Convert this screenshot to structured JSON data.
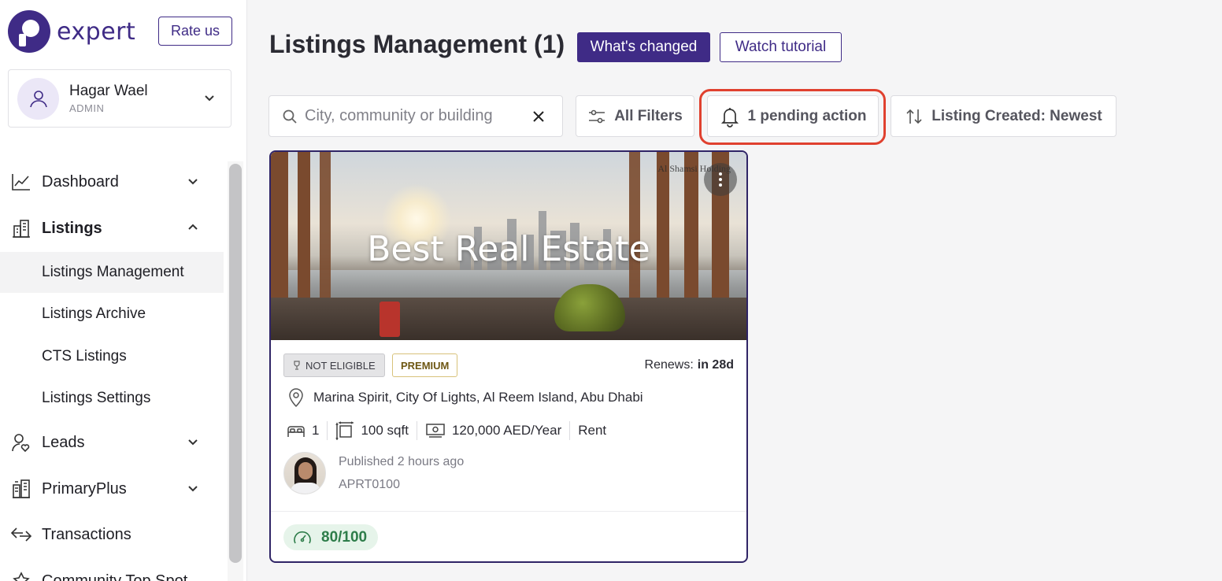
{
  "brand": {
    "name": "expert",
    "rate_label": "Rate us"
  },
  "user": {
    "name": "Hagar Wael",
    "role": "ADMIN"
  },
  "nav": {
    "dashboard": "Dashboard",
    "listings": "Listings",
    "listings_sub": [
      "Listings Management",
      "Listings Archive",
      "CTS Listings",
      "Listings Settings"
    ],
    "leads": "Leads",
    "primaryplus": "PrimaryPlus",
    "transactions": "Transactions",
    "community": "Community Top Spot"
  },
  "header": {
    "title": "Listings Management (1)",
    "whats_changed": "What's changed",
    "watch_tutorial": "Watch tutorial"
  },
  "toolbar": {
    "search_placeholder": "City, community or building",
    "all_filters": "All Filters",
    "pending_action": "1 pending action",
    "sort_label": "Listing Created: Newest"
  },
  "listing": {
    "hero_text": "Best Real Estate",
    "hero_brand": "Al Shamsi Holding",
    "badge_eligibility": "NOT ELIGIBLE",
    "badge_tier": "PREMIUM",
    "renews_label": "Renews:",
    "renews_value": "in 28d",
    "location": "Marina Spirit, City Of Lights, Al Reem Island, Abu Dhabi",
    "bedrooms": "1",
    "area": "100 sqft",
    "price": "120,000 AED/Year",
    "purpose": "Rent",
    "published": "Published 2 hours ago",
    "reference": "APRT0100",
    "quality_score": "80/100"
  },
  "colors": {
    "primary": "#3f2b86",
    "highlight": "#e0412f",
    "score_green": "#2e7d4a"
  }
}
